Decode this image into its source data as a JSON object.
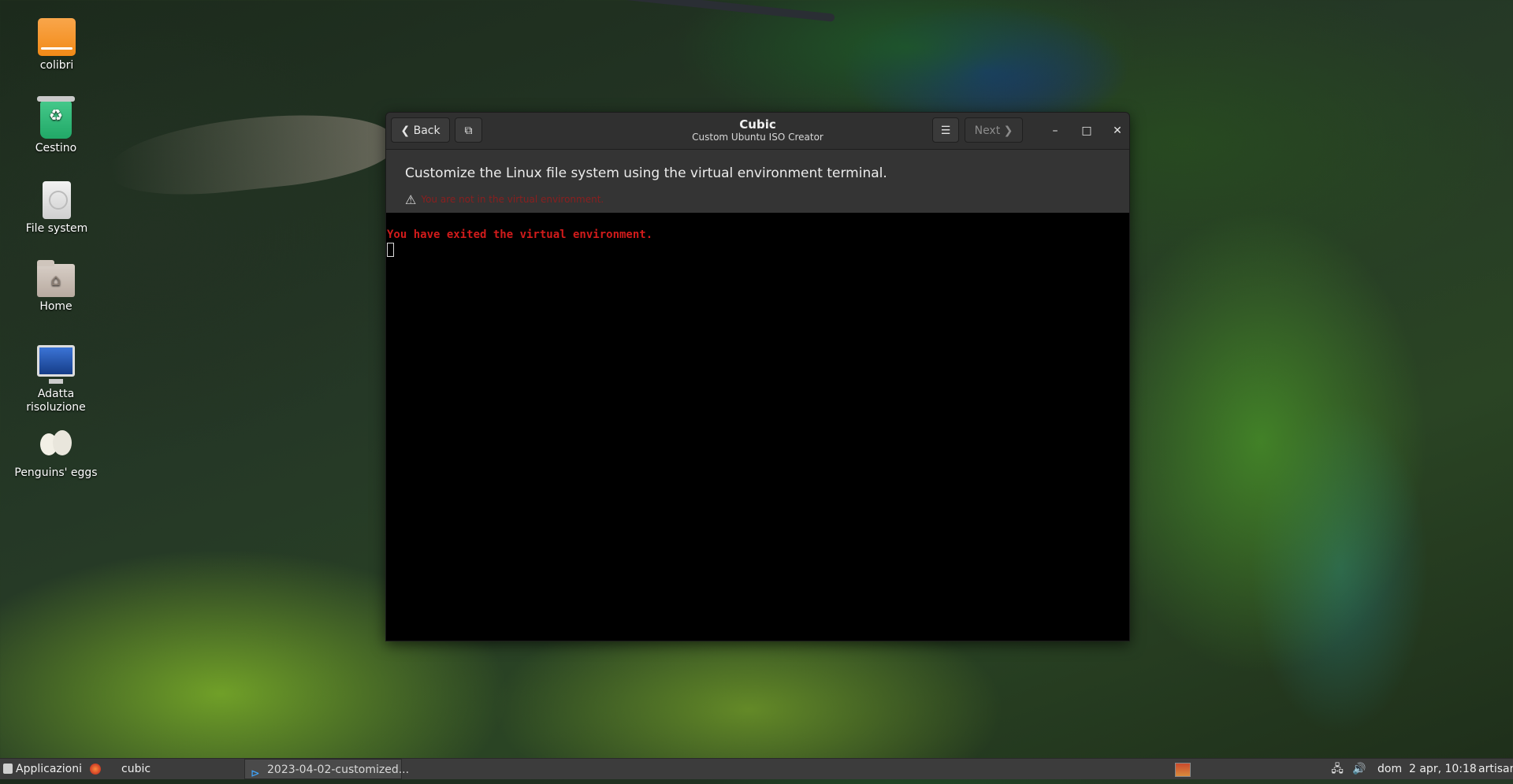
{
  "desktop": {
    "icons": [
      {
        "label": "colibri",
        "icon": "drive-icon"
      },
      {
        "label": "Cestino",
        "icon": "trash-icon"
      },
      {
        "label": "File system",
        "icon": "harddisk-icon"
      },
      {
        "label": "Home",
        "icon": "home-folder-icon"
      },
      {
        "label": "Adatta risoluzione",
        "icon": "monitor-icon"
      },
      {
        "label": "Penguins' eggs",
        "icon": "eggs-icon"
      }
    ]
  },
  "window": {
    "title": "Cubic",
    "subtitle": "Custom Ubuntu ISO Creator",
    "back_label": "❮ Back",
    "next_label": "Next ❯",
    "copy_icon": "copy-icon",
    "menu_icon": "hamburger-menu-icon",
    "minimize_glyph": "–",
    "maximize_glyph": "□",
    "close_glyph": "✕",
    "instruction": "Customize the Linux file system using the virtual environment terminal.",
    "warning": "You are not in the virtual environment.",
    "terminal": {
      "line": "You have exited the virtual environment."
    }
  },
  "taskbar": {
    "apps_menu": "Applicazioni",
    "separator": "⋮",
    "tasks": [
      {
        "label": "cubic",
        "icon": "cubic-app-icon"
      },
      {
        "label": "2023-04-02-customized...",
        "icon": "vscode-icon"
      }
    ],
    "tray": {
      "network_icon": "network-icon",
      "volume_icon": "volume-icon"
    },
    "clock": "dom  2 apr, 10:18",
    "user": "artisan"
  },
  "colors": {
    "terminal_text": "#d11b1b",
    "warning_text": "#8a1f1f",
    "window_bg": "#2b2b2b"
  }
}
